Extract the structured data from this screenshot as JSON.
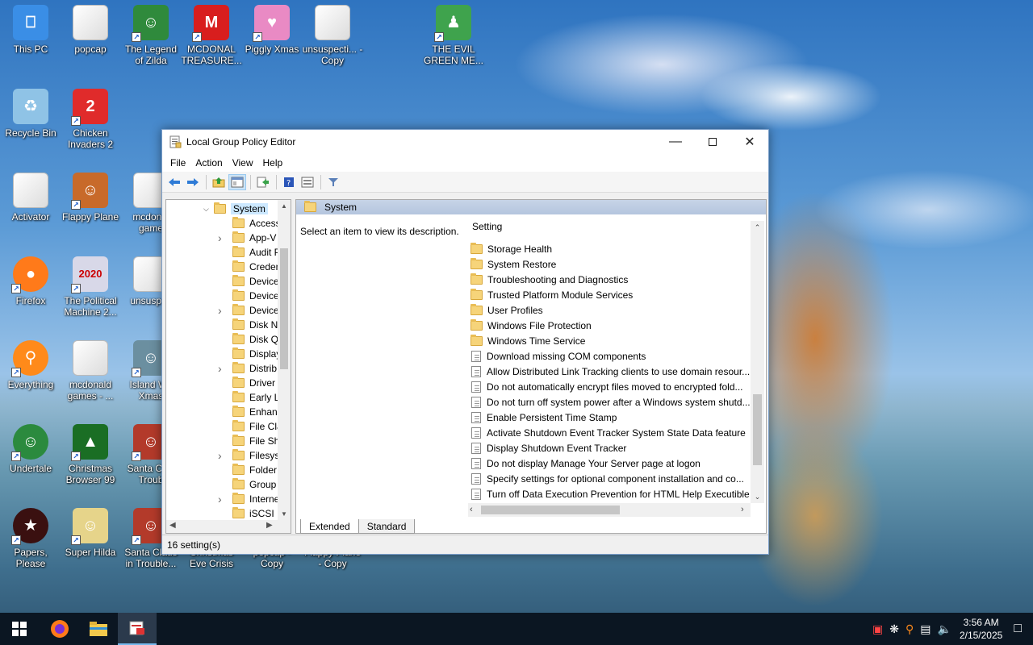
{
  "desktop": {
    "icons": [
      {
        "label": "This PC",
        "icon": "computer-icon",
        "color": "#3a8ee6"
      },
      {
        "label": "popcap",
        "icon": "file-icon",
        "color": "#888888"
      },
      {
        "label": "The Legend of Zilda",
        "icon": "game-icon",
        "color": "#2f8a3c"
      },
      {
        "label": "MCDONAL TREASURE...",
        "icon": "mcdonalds-icon",
        "color": "#d81e1e"
      },
      {
        "label": "Piggly Xmas",
        "icon": "pig-icon",
        "color": "#e98ac4"
      },
      {
        "label": "unsuspecti... - Copy",
        "icon": "file-icon",
        "color": "#cccccc"
      },
      {
        "label": "THE EVIL GREEN ME...",
        "icon": "msn-icon",
        "color": "#3fa34d"
      },
      {
        "label": "Recycle Bin",
        "icon": "recycle-bin-icon",
        "color": "#8fc3e6"
      },
      {
        "label": "Chicken Invaders 2",
        "icon": "chicken-icon",
        "color": "#e02b2b"
      },
      {
        "label": "Activator",
        "icon": "file-icon",
        "color": "#cccccc"
      },
      {
        "label": "Flappy Plane",
        "icon": "game-icon",
        "color": "#c86a2a"
      },
      {
        "label": "mcdonal game",
        "icon": "file-icon",
        "color": "#cccccc"
      },
      {
        "label": "Firefox",
        "icon": "firefox-icon",
        "color": "#ff7a1a"
      },
      {
        "label": "The Political Machine 2...",
        "icon": "political-icon",
        "color": "#d8d8e8"
      },
      {
        "label": "unsuspec",
        "icon": "file-icon",
        "color": "#cccccc"
      },
      {
        "label": "Everything",
        "icon": "search-icon",
        "color": "#ff8a1a"
      },
      {
        "label": "mcdonald games - ...",
        "icon": "file-icon",
        "color": "#cccccc"
      },
      {
        "label": "Island Wa Xmas",
        "icon": "game-icon",
        "color": "#6b8fa0"
      },
      {
        "label": "Undertale",
        "icon": "undertale-icon",
        "color": "#2b8a3e"
      },
      {
        "label": "Christmas Browser 99",
        "icon": "tree-icon",
        "color": "#1a6e24"
      },
      {
        "label": "Santa Cl in Troub",
        "icon": "santa-icon",
        "color": "#b33a2a"
      },
      {
        "label": "Papers, Please",
        "icon": "papers-icon",
        "color": "#3a1010"
      },
      {
        "label": "Super Hilda",
        "icon": "game-icon",
        "color": "#e6d48a"
      },
      {
        "label": "Santa Claus in Trouble...",
        "icon": "santa-icon",
        "color": "#b33a2a"
      },
      {
        "label": "Christmas Eve Crisis",
        "icon": "game-icon",
        "color": "#4a6a8a"
      },
      {
        "label": "popcap - Copy",
        "icon": "file-icon",
        "color": "#cccccc"
      },
      {
        "label": "Flappy Plane - Copy",
        "icon": "game-icon",
        "color": "#c86a2a"
      }
    ]
  },
  "window": {
    "title": "Local Group Policy Editor",
    "menu": [
      "File",
      "Action",
      "View",
      "Help"
    ],
    "tree": {
      "root": "System",
      "items": [
        "Access",
        "App-V",
        "Audit P",
        "Creden",
        "Device",
        "Device",
        "Device",
        "Disk N",
        "Disk Q",
        "Display",
        "Distrib",
        "Driver",
        "Early L",
        "Enhan",
        "File Cla",
        "File Sh",
        "Filesys",
        "Folder",
        "Group",
        "Interne",
        "iSCSI"
      ]
    },
    "panel": {
      "header": "System",
      "description": "Select an item to view its description.",
      "column_header": "Setting",
      "folders": [
        "Storage Health",
        "System Restore",
        "Troubleshooting and Diagnostics",
        "Trusted Platform Module Services",
        "User Profiles",
        "Windows File Protection",
        "Windows Time Service"
      ],
      "settings": [
        "Download missing COM components",
        "Allow Distributed Link Tracking clients to use domain resour...",
        "Do not automatically encrypt files moved to encrypted fold...",
        "Do not turn off system power after a Windows system shutd...",
        "Enable Persistent Time Stamp",
        "Activate Shutdown Event Tracker System State Data feature",
        "Display Shutdown Event Tracker",
        "Do not display Manage Your Server page at logon",
        "Specify settings for optional component installation and co...",
        "Turn off Data Execution Prevention for HTML Help Executible"
      ]
    },
    "tabs": [
      "Extended",
      "Standard"
    ],
    "status": "16 setting(s)"
  },
  "taskbar": {
    "time": "3:56 AM",
    "date": "2/15/2025"
  }
}
